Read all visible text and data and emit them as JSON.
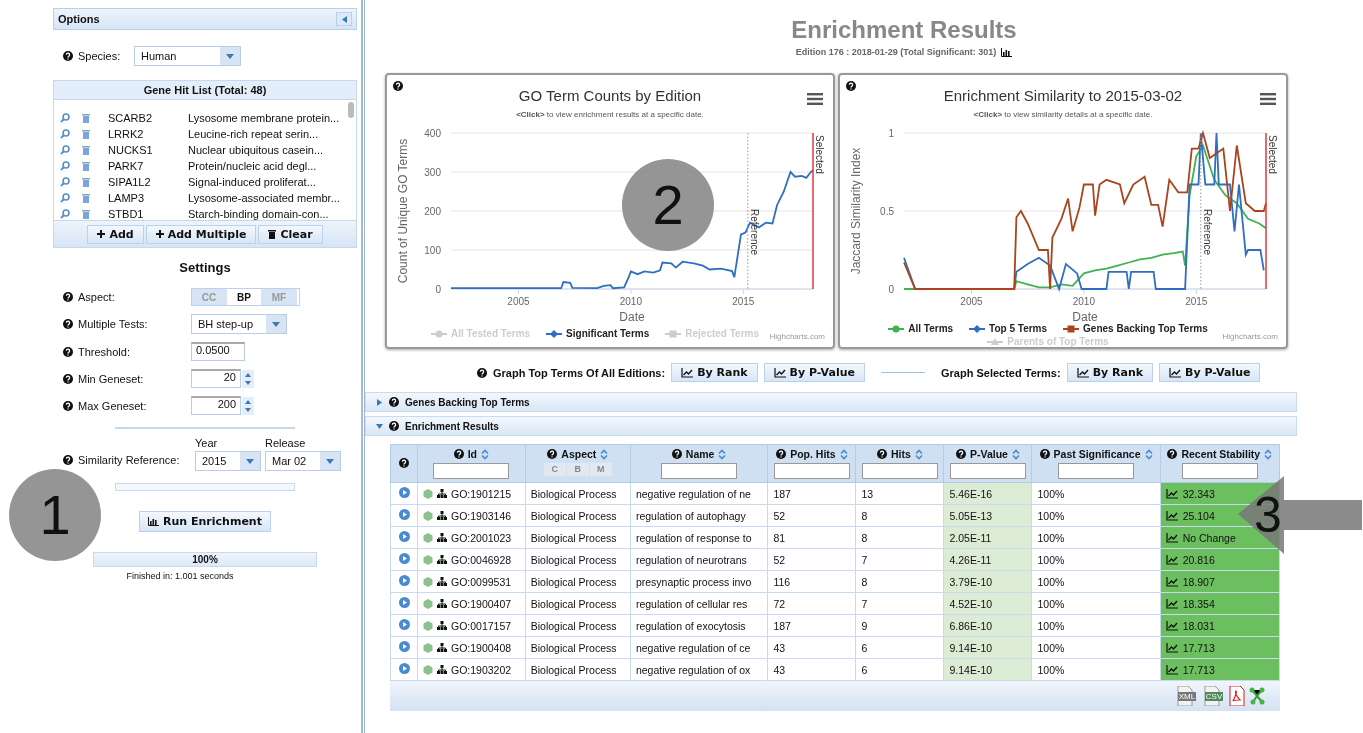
{
  "sidebar": {
    "title": "Options",
    "species": {
      "label": "Species:",
      "value": "Human"
    },
    "gene_list": {
      "title": "Gene Hit List (Total: 48)",
      "items": [
        {
          "symbol": "SCARB2",
          "description": "Lysosome membrane protein..."
        },
        {
          "symbol": "LRRK2",
          "description": "Leucine-rich repeat serin..."
        },
        {
          "symbol": "NUCKS1",
          "description": "Nuclear ubiquitous casein..."
        },
        {
          "symbol": "PARK7",
          "description": "Protein/nucleic acid degl..."
        },
        {
          "symbol": "SIPA1L2",
          "description": "Signal-induced proliferat..."
        },
        {
          "symbol": "LAMP3",
          "description": "Lysosome-associated membr..."
        },
        {
          "symbol": "STBD1",
          "description": "Starch-binding domain-con..."
        }
      ],
      "buttons": [
        {
          "label": "Add",
          "kind": "add"
        },
        {
          "label": "Add Multiple",
          "kind": "add"
        },
        {
          "label": "Clear",
          "kind": "clear"
        }
      ]
    },
    "settings": {
      "title": "Settings",
      "aspect": {
        "label": "Aspect:",
        "options": [
          {
            "label": "CC",
            "selected": false
          },
          {
            "label": "BP",
            "selected": true
          },
          {
            "label": "MF",
            "selected": false
          }
        ]
      },
      "fields": [
        {
          "label": "Multiple Tests:",
          "value": "BH step-up",
          "kind": "select"
        },
        {
          "label": "Threshold:",
          "value": "0.0500",
          "kind": "text"
        },
        {
          "label": "Min Geneset:",
          "value": "20",
          "kind": "spinner"
        },
        {
          "label": "Max Geneset:",
          "value": "200",
          "kind": "spinner"
        }
      ],
      "similarity": {
        "label": "Similarity Reference:",
        "year_label": "Year",
        "year": "2015",
        "release_label": "Release",
        "release": "Mar 02"
      }
    },
    "run_button": "Run Enrichment",
    "progress": {
      "level": 1,
      "text": "100%"
    },
    "status": "Finished in: 1.001 seconds"
  },
  "header": {
    "title": "Enrichment Results",
    "subtitle": "Edition 176 : 2018-01-29 (Total Significant: 301)"
  },
  "charts": [
    {
      "title": "GO Term Counts by Edition",
      "hint_key": "<Click>",
      "hint": "to view enrichment results at a specific date.",
      "credit": "Highcharts.com",
      "legend": [
        {
          "kind": "hidden",
          "label": "All Tested Terms",
          "visible": false,
          "color": "#cccccc"
        },
        {
          "kind": "series",
          "visible": true
        },
        {
          "kind": "hidden",
          "label": "Rejected Terms",
          "visible": false,
          "color": "#cccccc"
        }
      ],
      "chart_data": {
        "type": "line",
        "xlabel": "Date",
        "ylabel": "Count of Unique GO Terms",
        "xlim": [
          2002,
          2018.1
        ],
        "ylim": [
          0,
          400
        ],
        "xticks": [
          2005,
          2010,
          2015
        ],
        "yticks": [
          0,
          100,
          200,
          300,
          400
        ],
        "grid": true,
        "ref_lines": [
          {
            "axis": "x",
            "value": 2015.2,
            "label": "Reference",
            "color": "#999999"
          },
          {
            "axis": "x",
            "value": 2018.1,
            "label": "Selected",
            "color": "#e0393b"
          }
        ],
        "series": [
          {
            "name": "Significant Terms",
            "color": "#2f6fbf",
            "x": [
              2002,
              2004,
              2006,
              2006.9,
              2007,
              2007.3,
              2007.4,
              2008.5,
              2008.8,
              2009.1,
              2009.2,
              2009.7,
              2009.9,
              2010,
              2010.3,
              2010.6,
              2011,
              2011.3,
              2011.4,
              2011.8,
              2012,
              2012.3,
              2012.8,
              2013.2,
              2013.5,
              2014,
              2014.5,
              2014.6,
              2014.9,
              2015.1,
              2015.3,
              2015.7,
              2016,
              2016.3,
              2016.5,
              2016.8,
              2017.1,
              2017.3,
              2017.6,
              2017.8,
              2018,
              2018.1
            ],
            "values": [
              2,
              2,
              2,
              2,
              18,
              16,
              3,
              2,
              8,
              10,
              2,
              4,
              30,
              45,
              38,
              45,
              42,
              48,
              68,
              66,
              55,
              70,
              66,
              60,
              50,
              52,
              46,
              30,
              140,
              145,
              170,
              158,
              170,
              168,
              215,
              250,
              300,
              288,
              290,
              285,
              300,
              305
            ]
          }
        ]
      }
    },
    {
      "title": "Enrichment Similarity to 2015-03-02",
      "hint_key": "<Click>",
      "hint": "to view similarity details at a specific date.",
      "credit": "Highcharts.com",
      "legend": [
        {
          "kind": "series",
          "visible": true
        },
        {
          "kind": "series",
          "visible": true
        },
        {
          "kind": "series",
          "visible": true
        },
        {
          "kind": "hidden",
          "label": "Parents of Top Terms",
          "visible": false,
          "color": "#cccccc"
        }
      ],
      "chart_data": {
        "type": "line",
        "xlabel": "Date",
        "ylabel": "Jaccard Similarity Index",
        "xlim": [
          2002,
          2018.1
        ],
        "ylim": [
          0,
          1
        ],
        "xticks": [
          2005,
          2010,
          2015
        ],
        "yticks": [
          0,
          0.5,
          1
        ],
        "grid": true,
        "ref_lines": [
          {
            "axis": "x",
            "value": 2015.2,
            "label": "Reference",
            "color": "#999999"
          },
          {
            "axis": "x",
            "value": 2018.1,
            "label": "Selected",
            "color": "#e0393b"
          }
        ],
        "series": [
          {
            "name": "All Terms",
            "color": "#3fb34f",
            "x": [
              2002,
              2002.5,
              2006.9,
              2007,
              2007.5,
              2008,
              2008.5,
              2009,
              2009.5,
              2010,
              2010.5,
              2011,
              2011.5,
              2012,
              2012.5,
              2013,
              2013.5,
              2014,
              2014.4,
              2014.5,
              2014.7,
              2015,
              2015.3,
              2015.8,
              2016.3,
              2016.8,
              2017.3,
              2017.8,
              2018.1
            ],
            "values": [
              0,
              0,
              0,
              0.05,
              0.03,
              0.01,
              0.01,
              0.03,
              0.02,
              0.1,
              0.12,
              0.13,
              0.15,
              0.17,
              0.19,
              0.2,
              0.22,
              0.23,
              0.24,
              0.15,
              0.6,
              0.85,
              0.92,
              0.7,
              0.6,
              0.55,
              0.45,
              0.42,
              0.39
            ]
          },
          {
            "name": "Top 5 Terms",
            "color": "#2f6fbf",
            "x": [
              2002,
              2002.5,
              2006.9,
              2007,
              2007.5,
              2008,
              2008.5,
              2008.9,
              2009.2,
              2009.7,
              2009.9,
              2011,
              2011.1,
              2011.9,
              2012,
              2012.1,
              2013.1,
              2013.2,
              2014.5,
              2014.7,
              2015.1,
              2015.2,
              2015.4,
              2015.8,
              2015.9,
              2016,
              2016.5,
              2016.7,
              2016.9,
              2017.2,
              2017.3,
              2017.85,
              2018
            ],
            "values": [
              0.2,
              0,
              0,
              0.11,
              0.16,
              0.2,
              0.15,
              0,
              0.16,
              0.1,
              0,
              0,
              0.11,
              0.11,
              0,
              0.11,
              0.11,
              0,
              0,
              0.67,
              0.67,
              1,
              0.67,
              0.67,
              1,
              0.67,
              0.67,
              0.37,
              0.67,
              0.22,
              0.25,
              0.25,
              0.12
            ]
          },
          {
            "name": "Genes Backing Top Terms",
            "color": "#a9441e",
            "x": [
              2002,
              2002.5,
              2006.9,
              2007,
              2007.2,
              2007.5,
              2008,
              2008.4,
              2008.5,
              2008.6,
              2009,
              2009.3,
              2009.5,
              2009.8,
              2010,
              2010.4,
              2010.5,
              2010.7,
              2011,
              2011.6,
              2011.8,
              2012.2,
              2012.7,
              2013,
              2013.3,
              2013.5,
              2013.8,
              2014.2,
              2014.6,
              2014.8,
              2015.1,
              2015.3,
              2015.6,
              2016.2,
              2016.5,
              2016.8,
              2017.2,
              2017.6,
              2018,
              2018.1
            ],
            "values": [
              0.17,
              0,
              0,
              0.46,
              0.5,
              0.42,
              0.25,
              0.25,
              0,
              0.33,
              0.45,
              0.58,
              0.37,
              0.52,
              0.67,
              0.67,
              0.47,
              0.67,
              0.7,
              0.67,
              0.55,
              0.67,
              0.72,
              0.54,
              0.54,
              0.4,
              0.7,
              0.62,
              0.62,
              0.9,
              0.9,
              1,
              0.84,
              0.9,
              0.5,
              0.92,
              0.55,
              0.5,
              0.5,
              0.55
            ]
          }
        ]
      }
    }
  ],
  "graph_controls": [
    {
      "label": "Graph Top Terms Of All Editions:",
      "buttons": [
        "By Rank",
        "By P-Value"
      ]
    },
    {
      "label": "Graph Selected Terms:",
      "buttons": [
        "By Rank",
        "By P-Value"
      ]
    }
  ],
  "sections": [
    {
      "title": "Genes Backing Top Terms",
      "expanded": false
    },
    {
      "title": "Enrichment Results",
      "expanded": true
    }
  ],
  "table": {
    "columns": [
      {
        "label": "Id"
      },
      {
        "label": "Aspect",
        "filters": [
          "C",
          "B",
          "M"
        ]
      },
      {
        "label": "Name"
      },
      {
        "label": "Pop. Hits"
      },
      {
        "label": "Hits"
      },
      {
        "label": "P-Value"
      },
      {
        "label": "Past Significance"
      },
      {
        "label": "Recent Stability"
      }
    ],
    "rows": [
      {
        "id": "GO:1901215",
        "aspect": "Biological Process",
        "name": "negative regulation of ne",
        "pop_hits": "187",
        "hits": "13",
        "p_value": "5.46E-16",
        "past_significance": "100%",
        "recent_stability": "32.343"
      },
      {
        "id": "GO:1903146",
        "aspect": "Biological Process",
        "name": "regulation of autophagy",
        "pop_hits": "52",
        "hits": "8",
        "p_value": "5.05E-13",
        "past_significance": "100%",
        "recent_stability": "25.104"
      },
      {
        "id": "GO:2001023",
        "aspect": "Biological Process",
        "name": "regulation of response to",
        "pop_hits": "81",
        "hits": "8",
        "p_value": "2.05E-11",
        "past_significance": "100%",
        "recent_stability": "No Change"
      },
      {
        "id": "GO:0046928",
        "aspect": "Biological Process",
        "name": "regulation of neurotrans",
        "pop_hits": "52",
        "hits": "7",
        "p_value": "4.26E-11",
        "past_significance": "100%",
        "recent_stability": "20.816"
      },
      {
        "id": "GO:0099531",
        "aspect": "Biological Process",
        "name": "presynaptic process invo",
        "pop_hits": "116",
        "hits": "8",
        "p_value": "3.79E-10",
        "past_significance": "100%",
        "recent_stability": "18.907"
      },
      {
        "id": "GO:1900407",
        "aspect": "Biological Process",
        "name": "regulation of cellular res",
        "pop_hits": "72",
        "hits": "7",
        "p_value": "4.52E-10",
        "past_significance": "100%",
        "recent_stability": "18.354"
      },
      {
        "id": "GO:0017157",
        "aspect": "Biological Process",
        "name": "regulation of exocytosis",
        "pop_hits": "187",
        "hits": "9",
        "p_value": "6.86E-10",
        "past_significance": "100%",
        "recent_stability": "18.031"
      },
      {
        "id": "GO:1900408",
        "aspect": "Biological Process",
        "name": "negative regulation of ce",
        "pop_hits": "43",
        "hits": "6",
        "p_value": "9.14E-10",
        "past_significance": "100%",
        "recent_stability": "17.713"
      },
      {
        "id": "GO:1903202",
        "aspect": "Biological Process",
        "name": "negative regulation of ox",
        "pop_hits": "43",
        "hits": "6",
        "p_value": "9.14E-10",
        "past_significance": "100%",
        "recent_stability": "17.713"
      }
    ],
    "exports": [
      {
        "label": "XML",
        "kind": "xml"
      },
      {
        "label": "CSV",
        "kind": "csv"
      },
      {
        "kind": "pdf"
      },
      {
        "kind": "network"
      }
    ]
  },
  "callouts": [
    {
      "label": "1",
      "kind": "circle"
    },
    {
      "label": "2",
      "kind": "circle"
    },
    {
      "label": "3",
      "kind": "arrow"
    }
  ]
}
